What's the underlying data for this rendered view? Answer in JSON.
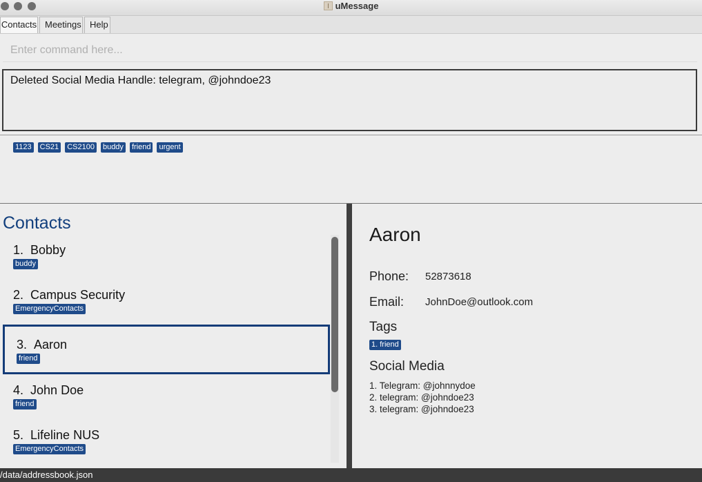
{
  "window": {
    "title": "uMessage"
  },
  "menu": {
    "items": [
      "Contacts",
      "Meetings",
      "Help"
    ]
  },
  "command": {
    "placeholder": "Enter command here...",
    "value": ""
  },
  "result": {
    "text": "Deleted Social Media Handle: telegram, @johndoe23"
  },
  "tag_bar": [
    "1123",
    "CS21",
    "CS2100",
    "buddy",
    "friend",
    "urgent"
  ],
  "contacts": {
    "title": "Contacts",
    "items": [
      {
        "index": "1.",
        "name": "Bobby",
        "tags": [
          "buddy"
        ],
        "selected": false
      },
      {
        "index": "2.",
        "name": "Campus Security",
        "tags": [
          "EmergencyContacts"
        ],
        "selected": false
      },
      {
        "index": "3.",
        "name": "Aaron",
        "tags": [
          "friend"
        ],
        "selected": true
      },
      {
        "index": "4.",
        "name": "John Doe",
        "tags": [
          "friend"
        ],
        "selected": false
      },
      {
        "index": "5.",
        "name": "Lifeline NUS",
        "tags": [
          "EmergencyContacts"
        ],
        "selected": false
      }
    ]
  },
  "details": {
    "name": "Aaron",
    "phone_label": "Phone:",
    "phone": "52873618",
    "email_label": "Email:",
    "email": "JohnDoe@outlook.com",
    "tags_title": "Tags",
    "tags": [
      "1. friend"
    ],
    "social_title": "Social Media",
    "social": [
      "1. Telegram: @johnnydoe",
      "2. telegram: @johndoe23",
      "3. telegram: @johndoe23"
    ]
  },
  "status": {
    "path": "/data/addressbook.json"
  },
  "colors": {
    "tag_bg": "#1f4b8a",
    "accent": "#123f7d",
    "selected_border": "#143c78",
    "status_bg": "#3a3a3a"
  },
  "icons": {
    "app": "app-icon",
    "window_controls": [
      "close-icon",
      "minimize-icon",
      "zoom-icon"
    ]
  }
}
